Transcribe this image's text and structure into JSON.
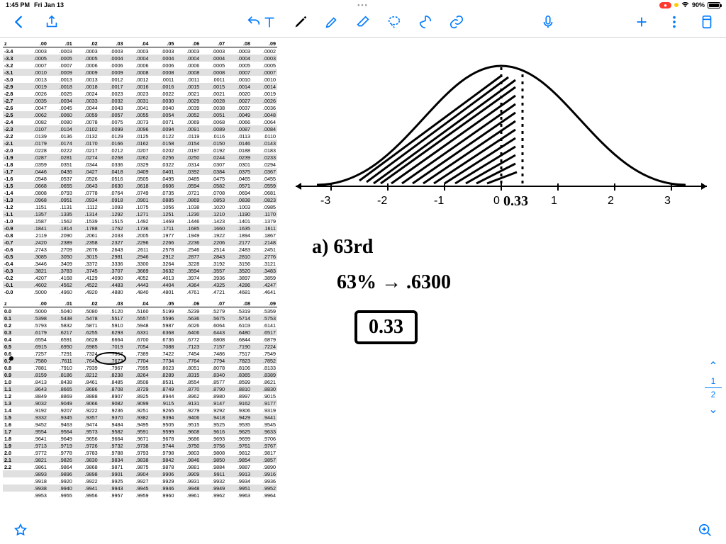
{
  "status": {
    "time": "1:45 PM",
    "date": "Fri Jan 13",
    "recording": "●",
    "battery_pct": "90%"
  },
  "toolbar": {
    "back": "Back",
    "undo": "Undo"
  },
  "answer": {
    "label_a": "a)   63rd",
    "conversion": "63% → .6300",
    "boxed": "0.33",
    "z_annotation": "0.33"
  },
  "axis": {
    "m3": "-3",
    "m2": "-2",
    "m1": "-1",
    "z": "0",
    "p1": "1",
    "p2": "2",
    "p3": "3"
  },
  "page": {
    "cur": "1",
    "tot": "2"
  },
  "ztable": {
    "cols": [
      "z",
      ".00",
      ".01",
      ".02",
      ".03",
      ".04",
      ".05",
      ".06",
      ".07",
      ".08",
      ".09"
    ],
    "neg": [
      [
        "-3.4",
        ".0003",
        ".0003",
        ".0003",
        ".0003",
        ".0003",
        ".0003",
        ".0003",
        ".0003",
        ".0003",
        ".0002"
      ],
      [
        "-3.3",
        ".0005",
        ".0005",
        ".0005",
        ".0004",
        ".0004",
        ".0004",
        ".0004",
        ".0004",
        ".0004",
        ".0003"
      ],
      [
        "-3.2",
        ".0007",
        ".0007",
        ".0006",
        ".0006",
        ".0006",
        ".0006",
        ".0006",
        ".0005",
        ".0005",
        ".0005"
      ],
      [
        "-3.1",
        ".0010",
        ".0009",
        ".0009",
        ".0009",
        ".0008",
        ".0008",
        ".0008",
        ".0008",
        ".0007",
        ".0007"
      ],
      [
        "-3.0",
        ".0013",
        ".0013",
        ".0013",
        ".0012",
        ".0012",
        ".0011",
        ".0011",
        ".0011",
        ".0010",
        ".0010"
      ],
      [
        "-2.9",
        ".0019",
        ".0018",
        ".0018",
        ".0017",
        ".0016",
        ".0016",
        ".0015",
        ".0015",
        ".0014",
        ".0014"
      ],
      [
        "-2.8",
        ".0026",
        ".0025",
        ".0024",
        ".0023",
        ".0023",
        ".0022",
        ".0021",
        ".0021",
        ".0020",
        ".0019"
      ],
      [
        "-2.7",
        ".0035",
        ".0034",
        ".0033",
        ".0032",
        ".0031",
        ".0030",
        ".0029",
        ".0028",
        ".0027",
        ".0026"
      ],
      [
        "-2.6",
        ".0047",
        ".0045",
        ".0044",
        ".0043",
        ".0041",
        ".0040",
        ".0039",
        ".0038",
        ".0037",
        ".0036"
      ],
      [
        "-2.5",
        ".0062",
        ".0060",
        ".0059",
        ".0057",
        ".0055",
        ".0054",
        ".0052",
        ".0051",
        ".0049",
        ".0048"
      ],
      [
        "-2.4",
        ".0082",
        ".0080",
        ".0078",
        ".0075",
        ".0073",
        ".0071",
        ".0069",
        ".0068",
        ".0066",
        ".0064"
      ],
      [
        "-2.3",
        ".0107",
        ".0104",
        ".0102",
        ".0099",
        ".0096",
        ".0094",
        ".0091",
        ".0089",
        ".0087",
        ".0084"
      ],
      [
        "-2.2",
        ".0139",
        ".0136",
        ".0132",
        ".0129",
        ".0125",
        ".0122",
        ".0119",
        ".0116",
        ".0113",
        ".0110"
      ],
      [
        "-2.1",
        ".0179",
        ".0174",
        ".0170",
        ".0166",
        ".0162",
        ".0158",
        ".0154",
        ".0150",
        ".0146",
        ".0143"
      ],
      [
        "-2.0",
        ".0228",
        ".0222",
        ".0217",
        ".0212",
        ".0207",
        ".0202",
        ".0197",
        ".0192",
        ".0188",
        ".0183"
      ],
      [
        "-1.9",
        ".0287",
        ".0281",
        ".0274",
        ".0268",
        ".0262",
        ".0256",
        ".0250",
        ".0244",
        ".0239",
        ".0233"
      ],
      [
        "-1.8",
        ".0359",
        ".0351",
        ".0344",
        ".0336",
        ".0329",
        ".0322",
        ".0314",
        ".0307",
        ".0301",
        ".0294"
      ],
      [
        "-1.7",
        ".0446",
        ".0436",
        ".0427",
        ".0418",
        ".0409",
        ".0401",
        ".0392",
        ".0384",
        ".0375",
        ".0367"
      ],
      [
        "-1.6",
        ".0548",
        ".0537",
        ".0526",
        ".0516",
        ".0505",
        ".0495",
        ".0485",
        ".0475",
        ".0465",
        ".0455"
      ],
      [
        "-1.5",
        ".0668",
        ".0655",
        ".0643",
        ".0630",
        ".0618",
        ".0606",
        ".0594",
        ".0582",
        ".0571",
        ".0559"
      ],
      [
        "-1.4",
        ".0808",
        ".0793",
        ".0778",
        ".0764",
        ".0749",
        ".0735",
        ".0721",
        ".0708",
        ".0694",
        ".0681"
      ],
      [
        "-1.3",
        ".0968",
        ".0951",
        ".0934",
        ".0918",
        ".0901",
        ".0885",
        ".0869",
        ".0853",
        ".0838",
        ".0823"
      ],
      [
        "-1.2",
        ".1151",
        ".1131",
        ".1112",
        ".1093",
        ".1075",
        ".1056",
        ".1038",
        ".1020",
        ".1003",
        ".0985"
      ],
      [
        "-1.1",
        ".1357",
        ".1335",
        ".1314",
        ".1292",
        ".1271",
        ".1251",
        ".1230",
        ".1210",
        ".1190",
        ".1170"
      ],
      [
        "-1.0",
        ".1587",
        ".1562",
        ".1539",
        ".1515",
        ".1492",
        ".1469",
        ".1446",
        ".1423",
        ".1401",
        ".1379"
      ],
      [
        "-0.9",
        ".1841",
        ".1814",
        ".1788",
        ".1762",
        ".1736",
        ".1711",
        ".1685",
        ".1660",
        ".1635",
        ".1611"
      ],
      [
        "-0.8",
        ".2119",
        ".2090",
        ".2061",
        ".2033",
        ".2005",
        ".1977",
        ".1949",
        ".1922",
        ".1894",
        ".1867"
      ],
      [
        "-0.7",
        ".2420",
        ".2389",
        ".2358",
        ".2327",
        ".2296",
        ".2266",
        ".2236",
        ".2206",
        ".2177",
        ".2148"
      ],
      [
        "-0.6",
        ".2743",
        ".2709",
        ".2676",
        ".2643",
        ".2611",
        ".2578",
        ".2546",
        ".2514",
        ".2483",
        ".2451"
      ],
      [
        "-0.5",
        ".3085",
        ".3050",
        ".3015",
        ".2981",
        ".2946",
        ".2912",
        ".2877",
        ".2843",
        ".2810",
        ".2776"
      ],
      [
        "-0.4",
        ".3446",
        ".3409",
        ".3372",
        ".3336",
        ".3300",
        ".3264",
        ".3228",
        ".3192",
        ".3156",
        ".3121"
      ],
      [
        "-0.3",
        ".3821",
        ".3783",
        ".3745",
        ".3707",
        ".3669",
        ".3632",
        ".3594",
        ".3557",
        ".3520",
        ".3483"
      ],
      [
        "-0.2",
        ".4207",
        ".4168",
        ".4129",
        ".4090",
        ".4052",
        ".4013",
        ".3974",
        ".3936",
        ".3897",
        ".3859"
      ],
      [
        "-0.1",
        ".4602",
        ".4562",
        ".4522",
        ".4483",
        ".4443",
        ".4404",
        ".4364",
        ".4325",
        ".4286",
        ".4247"
      ],
      [
        "-0.0",
        ".5000",
        ".4960",
        ".4920",
        ".4880",
        ".4840",
        ".4801",
        ".4761",
        ".4721",
        ".4681",
        ".4641"
      ]
    ],
    "pos": [
      [
        "0.0",
        ".5000",
        ".5040",
        ".5080",
        ".5120",
        ".5160",
        ".5199",
        ".5239",
        ".5279",
        ".5319",
        ".5359"
      ],
      [
        "0.1",
        ".5398",
        ".5438",
        ".5478",
        ".5517",
        ".5557",
        ".5596",
        ".5636",
        ".5675",
        ".5714",
        ".5753"
      ],
      [
        "0.2",
        ".5793",
        ".5832",
        ".5871",
        ".5910",
        ".5948",
        ".5987",
        ".6026",
        ".6064",
        ".6103",
        ".6141"
      ],
      [
        "0.3",
        ".6179",
        ".6217",
        ".6255",
        ".6293",
        ".6331",
        ".6368",
        ".6406",
        ".6443",
        ".6480",
        ".6517"
      ],
      [
        "0.4",
        ".6554",
        ".6591",
        ".6628",
        ".6664",
        ".6700",
        ".6736",
        ".6772",
        ".6808",
        ".6844",
        ".6879"
      ],
      [
        "0.5",
        ".6915",
        ".6950",
        ".6985",
        ".7019",
        ".7054",
        ".7088",
        ".7123",
        ".7157",
        ".7190",
        ".7224"
      ],
      [
        "0.6",
        ".7257",
        ".7291",
        ".7324",
        ".7357",
        ".7389",
        ".7422",
        ".7454",
        ".7486",
        ".7517",
        ".7549"
      ],
      [
        "0.7",
        ".7580",
        ".7611",
        ".7642",
        ".7673",
        ".7704",
        ".7734",
        ".7764",
        ".7794",
        ".7823",
        ".7852"
      ],
      [
        "0.8",
        ".7881",
        ".7910",
        ".7939",
        ".7967",
        ".7995",
        ".8023",
        ".8051",
        ".8078",
        ".8106",
        ".8133"
      ],
      [
        "0.9",
        ".8159",
        ".8186",
        ".8212",
        ".8238",
        ".8264",
        ".8289",
        ".8315",
        ".8340",
        ".8365",
        ".8389"
      ],
      [
        "1.0",
        ".8413",
        ".8438",
        ".8461",
        ".8485",
        ".8508",
        ".8531",
        ".8554",
        ".8577",
        ".8599",
        ".8621"
      ],
      [
        "1.1",
        ".8643",
        ".8665",
        ".8686",
        ".8708",
        ".8729",
        ".8749",
        ".8770",
        ".8790",
        ".8810",
        ".8830"
      ],
      [
        "1.2",
        ".8849",
        ".8869",
        ".8888",
        ".8907",
        ".8925",
        ".8944",
        ".8962",
        ".8980",
        ".8997",
        ".9015"
      ],
      [
        "1.3",
        ".9032",
        ".9049",
        ".9066",
        ".9082",
        ".9099",
        ".9115",
        ".9131",
        ".9147",
        ".9162",
        ".9177"
      ],
      [
        "1.4",
        ".9192",
        ".9207",
        ".9222",
        ".9236",
        ".9251",
        ".9265",
        ".9279",
        ".9292",
        ".9306",
        ".9319"
      ],
      [
        "1.5",
        ".9332",
        ".9345",
        ".9357",
        ".9370",
        ".9382",
        ".9394",
        ".9406",
        ".9418",
        ".9429",
        ".9441"
      ],
      [
        "1.6",
        ".9452",
        ".9463",
        ".9474",
        ".9484",
        ".9495",
        ".9505",
        ".9515",
        ".9525",
        ".9535",
        ".9545"
      ],
      [
        "1.7",
        ".9554",
        ".9564",
        ".9573",
        ".9582",
        ".9591",
        ".9599",
        ".9608",
        ".9616",
        ".9625",
        ".9633"
      ],
      [
        "1.8",
        ".9641",
        ".9649",
        ".9656",
        ".9664",
        ".9671",
        ".9678",
        ".9686",
        ".9693",
        ".9699",
        ".9706"
      ],
      [
        "1.9",
        ".9713",
        ".9719",
        ".9726",
        ".9732",
        ".9738",
        ".9744",
        ".9750",
        ".9756",
        ".9761",
        ".9767"
      ],
      [
        "2.0",
        ".9772",
        ".9778",
        ".9783",
        ".9788",
        ".9793",
        ".9798",
        ".9803",
        ".9808",
        ".9812",
        ".9817"
      ],
      [
        "2.1",
        ".9821",
        ".9826",
        ".9830",
        ".9834",
        ".9838",
        ".9842",
        ".9846",
        ".9850",
        ".9854",
        ".9857"
      ],
      [
        "2.2",
        ".9861",
        ".9864",
        ".9868",
        ".9871",
        ".9875",
        ".9878",
        ".9881",
        ".9884",
        ".9887",
        ".9890"
      ],
      [
        "",
        ".9893",
        ".9896",
        ".9898",
        ".9901",
        ".9904",
        ".9906",
        ".9909",
        ".9911",
        ".9913",
        ".9916"
      ],
      [
        "",
        ".9918",
        ".9920",
        ".9922",
        ".9925",
        ".9927",
        ".9929",
        ".9931",
        ".9932",
        ".9934",
        ".9936"
      ],
      [
        "",
        ".9938",
        ".9940",
        ".9941",
        ".9943",
        ".9945",
        ".9946",
        ".9948",
        ".9949",
        ".9951",
        ".9952"
      ],
      [
        "",
        ".9953",
        ".9955",
        ".9956",
        ".9957",
        ".9959",
        ".9960",
        ".9961",
        ".9962",
        ".9963",
        ".9964"
      ]
    ]
  }
}
